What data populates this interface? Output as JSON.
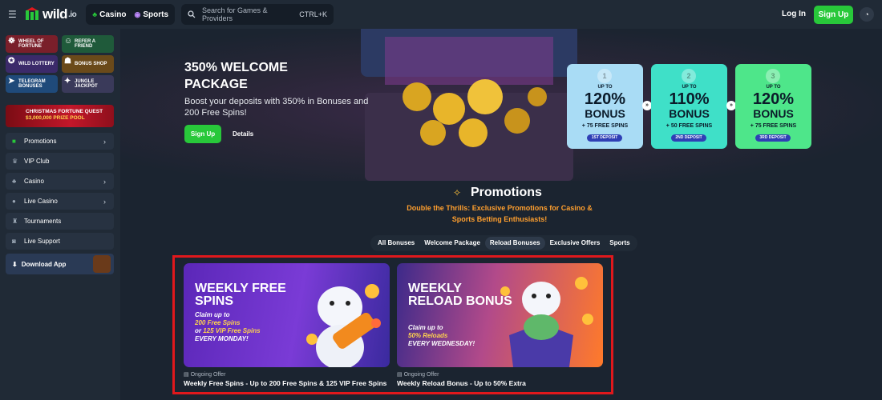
{
  "header": {
    "logo_text": "wild",
    "logo_tld": ".io",
    "tab_casino": "Casino",
    "tab_sports": "Sports",
    "search_placeholder": "Search for Games & Providers",
    "search_shortcut": "CTRL+K",
    "login_label": "Log In",
    "signup_label": "Sign Up"
  },
  "sidebar": {
    "tiles": [
      {
        "label": "Wheel of Fortune",
        "color": "#7a1f2a"
      },
      {
        "label": "Refer a Friend",
        "color": "#1f5a3a"
      },
      {
        "label": "Wild Lottery",
        "color": "#3b2a6a"
      },
      {
        "label": "Bonus Shop",
        "color": "#6a4a1a"
      },
      {
        "label": "Telegram Bonuses",
        "color": "#1f4a7a"
      },
      {
        "label": "Jungle Jackpot",
        "color": "#3a3a5a"
      }
    ],
    "xmas_line1": "Christmas Fortune Quest",
    "xmas_line2": "$3,000,000 prize pool",
    "nav": [
      {
        "label": "Promotions",
        "chevron": true
      },
      {
        "label": "VIP Club",
        "chevron": false
      },
      {
        "label": "Casino",
        "chevron": true
      },
      {
        "label": "Live Casino",
        "chevron": true
      },
      {
        "label": "Tournaments",
        "chevron": false
      },
      {
        "label": "Live Support",
        "chevron": false
      }
    ],
    "download_label": "Download App"
  },
  "hero": {
    "title": "350% WELCOME PACKAGE",
    "subtitle": "Boost your deposits with 350% in Bonuses and 200 Free Spins!",
    "signup_label": "Sign Up",
    "details_label": "Details",
    "cards": [
      {
        "num": "1",
        "upto": "UP TO",
        "pct": "120%",
        "bonus": "BONUS",
        "spins": "+ 75 FREE SPINS",
        "deposit": "1ST DEPOSIT",
        "color": "#a9dcf5"
      },
      {
        "num": "2",
        "upto": "UP TO",
        "pct": "110%",
        "bonus": "BONUS",
        "spins": "+ 50 FREE SPINS",
        "deposit": "2ND DEPOSIT",
        "color": "#3fe0c8"
      },
      {
        "num": "3",
        "upto": "UP TO",
        "pct": "120%",
        "bonus": "BONUS",
        "spins": "+ 75 FREE SPINS",
        "deposit": "3RD DEPOSIT",
        "color": "#4ee68a"
      }
    ]
  },
  "promotions": {
    "title": "Promotions",
    "subtitle": "Double the Thrills: Exclusive Promotions for Casino & Sports Betting Enthusiasts!",
    "filters": [
      "All Bonuses",
      "Welcome Package",
      "Reload Bonuses",
      "Exclusive Offers",
      "Sports"
    ],
    "cards": [
      {
        "banner_title": "WEEKLY FREE SPINS",
        "desc_a": "Claim up to",
        "desc_b": "200 Free Spins",
        "desc_c": "or",
        "desc_d": "125 VIP Free Spins",
        "desc_e": "EVERY MONDAY!",
        "tag": "Ongoing Offer",
        "title": "Weekly Free Spins - Up to 200 Free Spins & 125 VIP Free Spins"
      },
      {
        "banner_title": "WEEKLY RELOAD BONUS",
        "desc_a": "Claim up to",
        "desc_b": "50% Reloads",
        "desc_e": "EVERY WEDNESDAY!",
        "tag": "Ongoing Offer",
        "title": "Weekly Reload Bonus - Up to 50% Extra"
      }
    ]
  },
  "colors": {
    "accent_green": "#28c83a",
    "highlight_red": "#e0181c",
    "orange_text": "#ff9f2e"
  }
}
